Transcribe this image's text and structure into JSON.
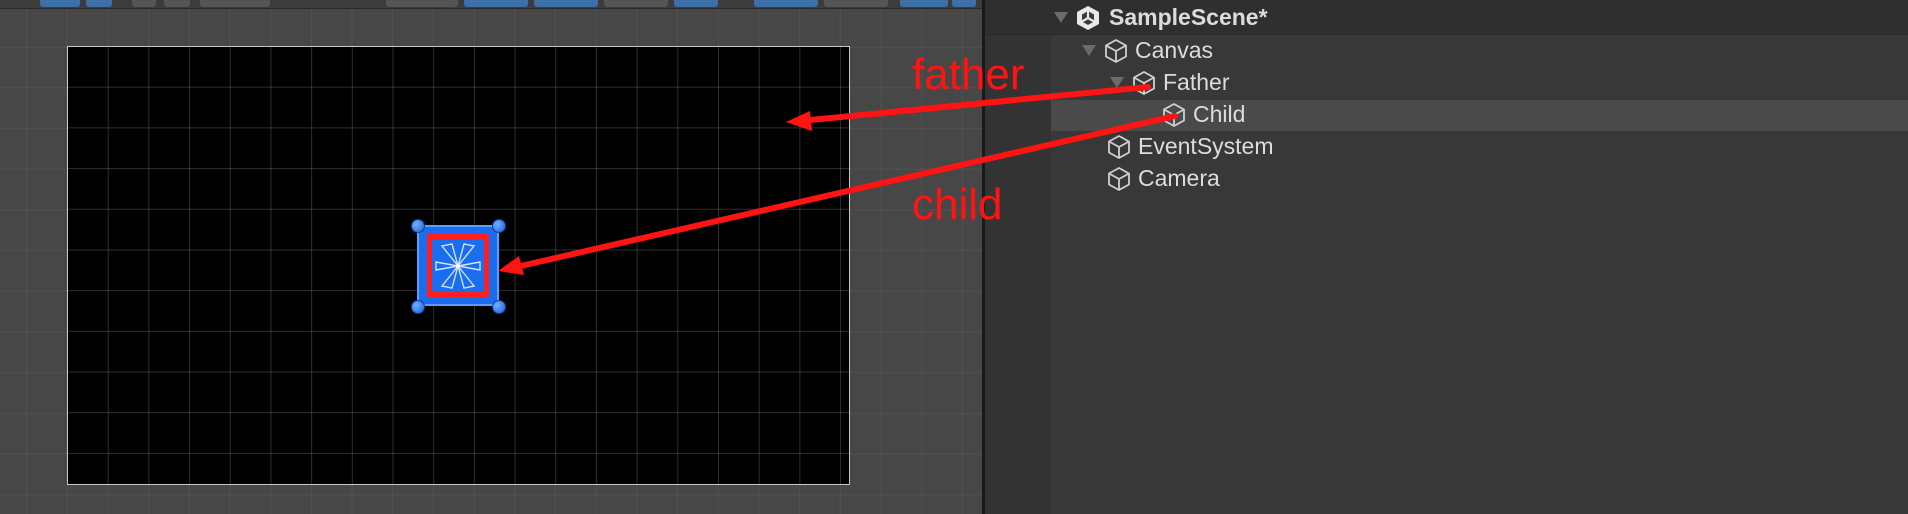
{
  "hierarchy": {
    "scene": {
      "name": "SampleScene*"
    },
    "items": [
      {
        "label": "Canvas"
      },
      {
        "label": "Father"
      },
      {
        "label": "Child"
      },
      {
        "label": "EventSystem"
      },
      {
        "label": "Camera"
      }
    ]
  },
  "annotations": {
    "father_label": "father",
    "child_label": "child",
    "color": "#ff1414"
  },
  "scene_view": {
    "canvas_color": "#000000",
    "selection_color": "#1b6df0"
  }
}
